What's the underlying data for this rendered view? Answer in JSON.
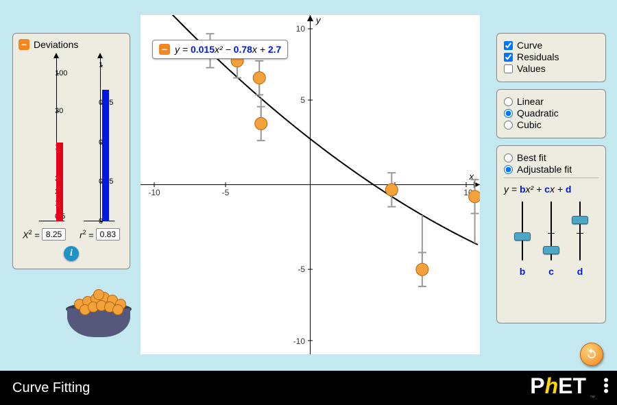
{
  "title": "Curve Fitting",
  "axes": {
    "x_label": "x",
    "y_label": "y",
    "xmin": -10,
    "xmax": 10,
    "ymin": -10,
    "ymax": 10,
    "xticks": [
      -10,
      -5,
      5,
      10
    ],
    "yticks": [
      -10,
      -5,
      5,
      10
    ]
  },
  "equation": {
    "prefix": "y = ",
    "b": "0.015",
    "bx": "x²",
    "op1": " − ",
    "c": "0.78",
    "cx": "x",
    "op2": " + ",
    "d": "2.7"
  },
  "deviations": {
    "header": "Deviations",
    "chi2_label": "X² =",
    "chi2_value": "8.25",
    "r2_label": "r² =",
    "r2_value": "0.83",
    "chi_ticks": [
      "0.5",
      "1",
      "2",
      "3",
      "10",
      "30",
      "100"
    ],
    "r_ticks": [
      "0",
      "0.25",
      "0.5",
      "0.75",
      "1"
    ],
    "chi_bar_frac": 0.52,
    "r_bar_frac": 0.83
  },
  "view_options": {
    "curve": "Curve",
    "residuals": "Residuals",
    "values": "Values",
    "curve_checked": true,
    "residuals_checked": true,
    "values_checked": false
  },
  "order_options": {
    "linear": "Linear",
    "quadratic": "Quadratic",
    "cubic": "Cubic",
    "selected": "quadratic"
  },
  "fit_options": {
    "best": "Best fit",
    "adjustable": "Adjustable fit",
    "selected": "adjustable",
    "eqn_html": "y = bx² + cx + d",
    "slider_b": {
      "label": "b",
      "pos": 0.5
    },
    "slider_c": {
      "label": "c",
      "pos": 0.68
    },
    "slider_d": {
      "label": "d",
      "pos": 0.28
    }
  },
  "chart_data": {
    "type": "scatter",
    "title": "Curve Fitting — quadratic adjustable fit",
    "xlabel": "x",
    "ylabel": "y",
    "xlim": [
      -10,
      10
    ],
    "ylim": [
      -10,
      10
    ],
    "points": [
      {
        "x": -5.9,
        "y": 7.9,
        "err": 1.0
      },
      {
        "x": -4.3,
        "y": 7.3,
        "err": 1.0
      },
      {
        "x": -3.0,
        "y": 6.3,
        "err": 1.0
      },
      {
        "x": -2.9,
        "y": 3.6,
        "err": 1.0
      },
      {
        "x": 4.8,
        "y": -0.3,
        "err": 1.0
      },
      {
        "x": 6.6,
        "y": -5.0,
        "err": 1.0
      },
      {
        "x": 9.7,
        "y": -0.7,
        "err": 1.0
      }
    ],
    "fit": {
      "type": "quadratic",
      "b": 0.015,
      "c": -0.78,
      "d": 2.7
    }
  }
}
